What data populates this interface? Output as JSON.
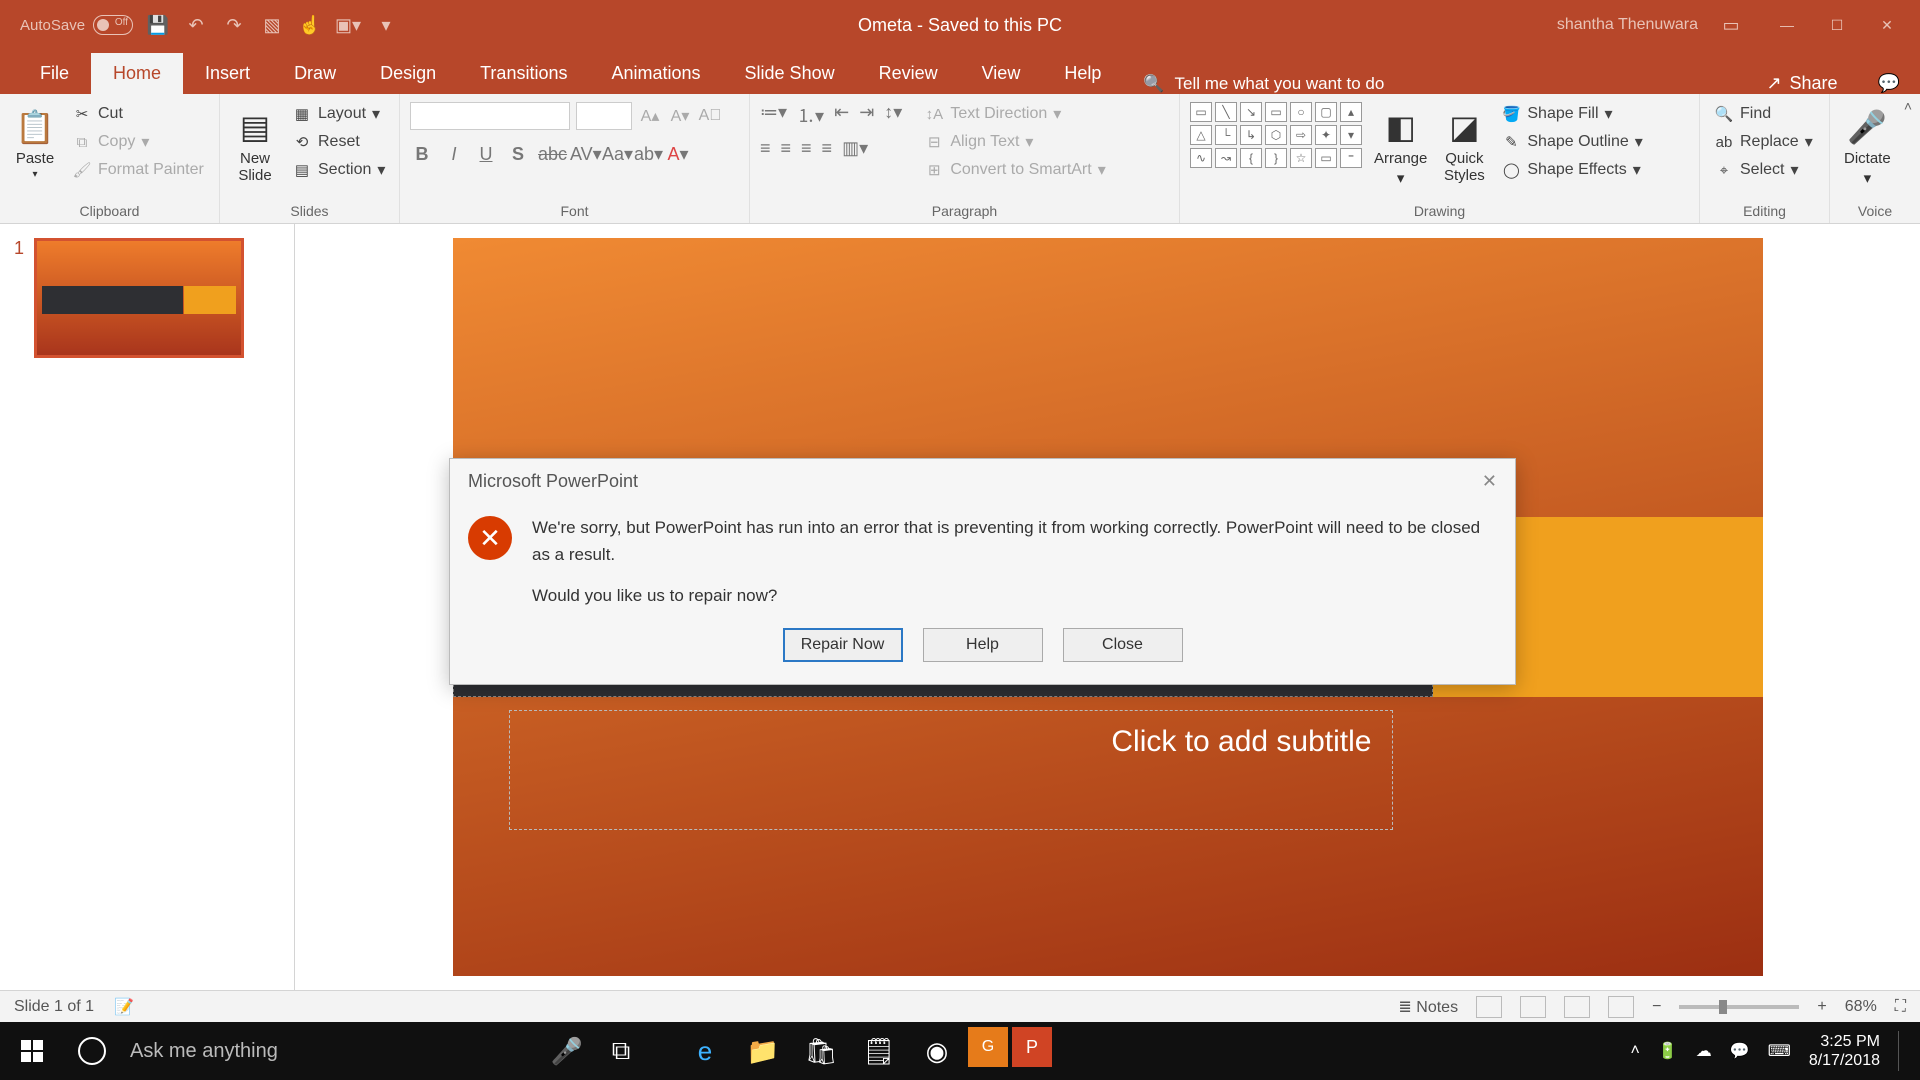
{
  "titleBar": {
    "autosave": "AutoSave",
    "autosaveState": "Off",
    "docTitle": "Ometa  -  Saved to this PC",
    "user": "shantha Thenuwara"
  },
  "tabs": {
    "file": "File",
    "home": "Home",
    "insert": "Insert",
    "draw": "Draw",
    "design": "Design",
    "transitions": "Transitions",
    "animations": "Animations",
    "slideshow": "Slide Show",
    "review": "Review",
    "view": "View",
    "help": "Help",
    "tellMe": "Tell me what you want to do",
    "share": "Share"
  },
  "ribbon": {
    "paste": "Paste",
    "cut": "Cut",
    "copy": "Copy",
    "formatPainter": "Format Painter",
    "clipboard": "Clipboard",
    "newSlide": "New\nSlide",
    "layout": "Layout",
    "reset": "Reset",
    "section": "Section",
    "slides": "Slides",
    "font": "Font",
    "paragraph": "Paragraph",
    "textDirection": "Text Direction",
    "alignText": "Align Text",
    "convertSmartArt": "Convert to SmartArt",
    "arrange": "Arrange",
    "quickStyles": "Quick\nStyles",
    "shapeFill": "Shape Fill",
    "shapeOutline": "Shape Outline",
    "shapeEffects": "Shape Effects",
    "drawing": "Drawing",
    "find": "Find",
    "replace": "Replace",
    "select": "Select",
    "editing": "Editing",
    "dictate": "Dictate",
    "voice": "Voice"
  },
  "slide": {
    "num": "1",
    "subtitle": "Click to add subtitle"
  },
  "dialog": {
    "title": "Microsoft PowerPoint",
    "line1": "We're sorry, but PowerPoint has run into an error that is preventing it from working correctly. PowerPoint will need to be closed as a result.",
    "line2": "Would you like us to repair now?",
    "repair": "Repair Now",
    "help": "Help",
    "close": "Close"
  },
  "status": {
    "slideCount": "Slide 1 of 1",
    "notes": "Notes",
    "zoom": "68%"
  },
  "taskbar": {
    "search": "Ask me anything",
    "time": "3:25 PM",
    "date": "8/17/2018"
  }
}
